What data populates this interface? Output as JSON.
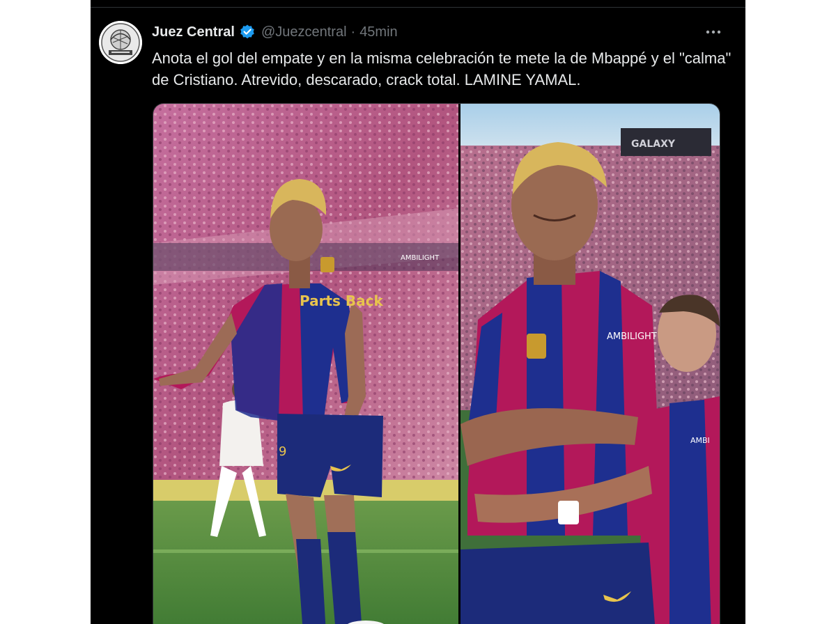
{
  "tweet": {
    "author_name": "Juez Central",
    "handle": "@Juezcentral",
    "separator": "·",
    "time": "45min",
    "more_label": "···",
    "text": "Anota el gol del empate y en la misma celebración te mete la de Mbappé y el \"calma\" de Cristiano. Atrevido, descarado, crack total. LAMINE YAMAL."
  },
  "media": {
    "left_photo": {
      "sponsor_text": "AMBILIGHT",
      "chest_text": "Parts Back",
      "number": "9"
    },
    "right_photo": {
      "board_text": "GALAXY",
      "sponsor_text": "AMBILIGHT",
      "sponsor_text_2": "AMBI"
    }
  },
  "colors": {
    "background": "#000000",
    "text": "#e7e9ea",
    "muted": "#71767b",
    "verified": "#1d9bf0",
    "barca_blue": "#1e2f8f",
    "barca_red": "#b3185a"
  }
}
